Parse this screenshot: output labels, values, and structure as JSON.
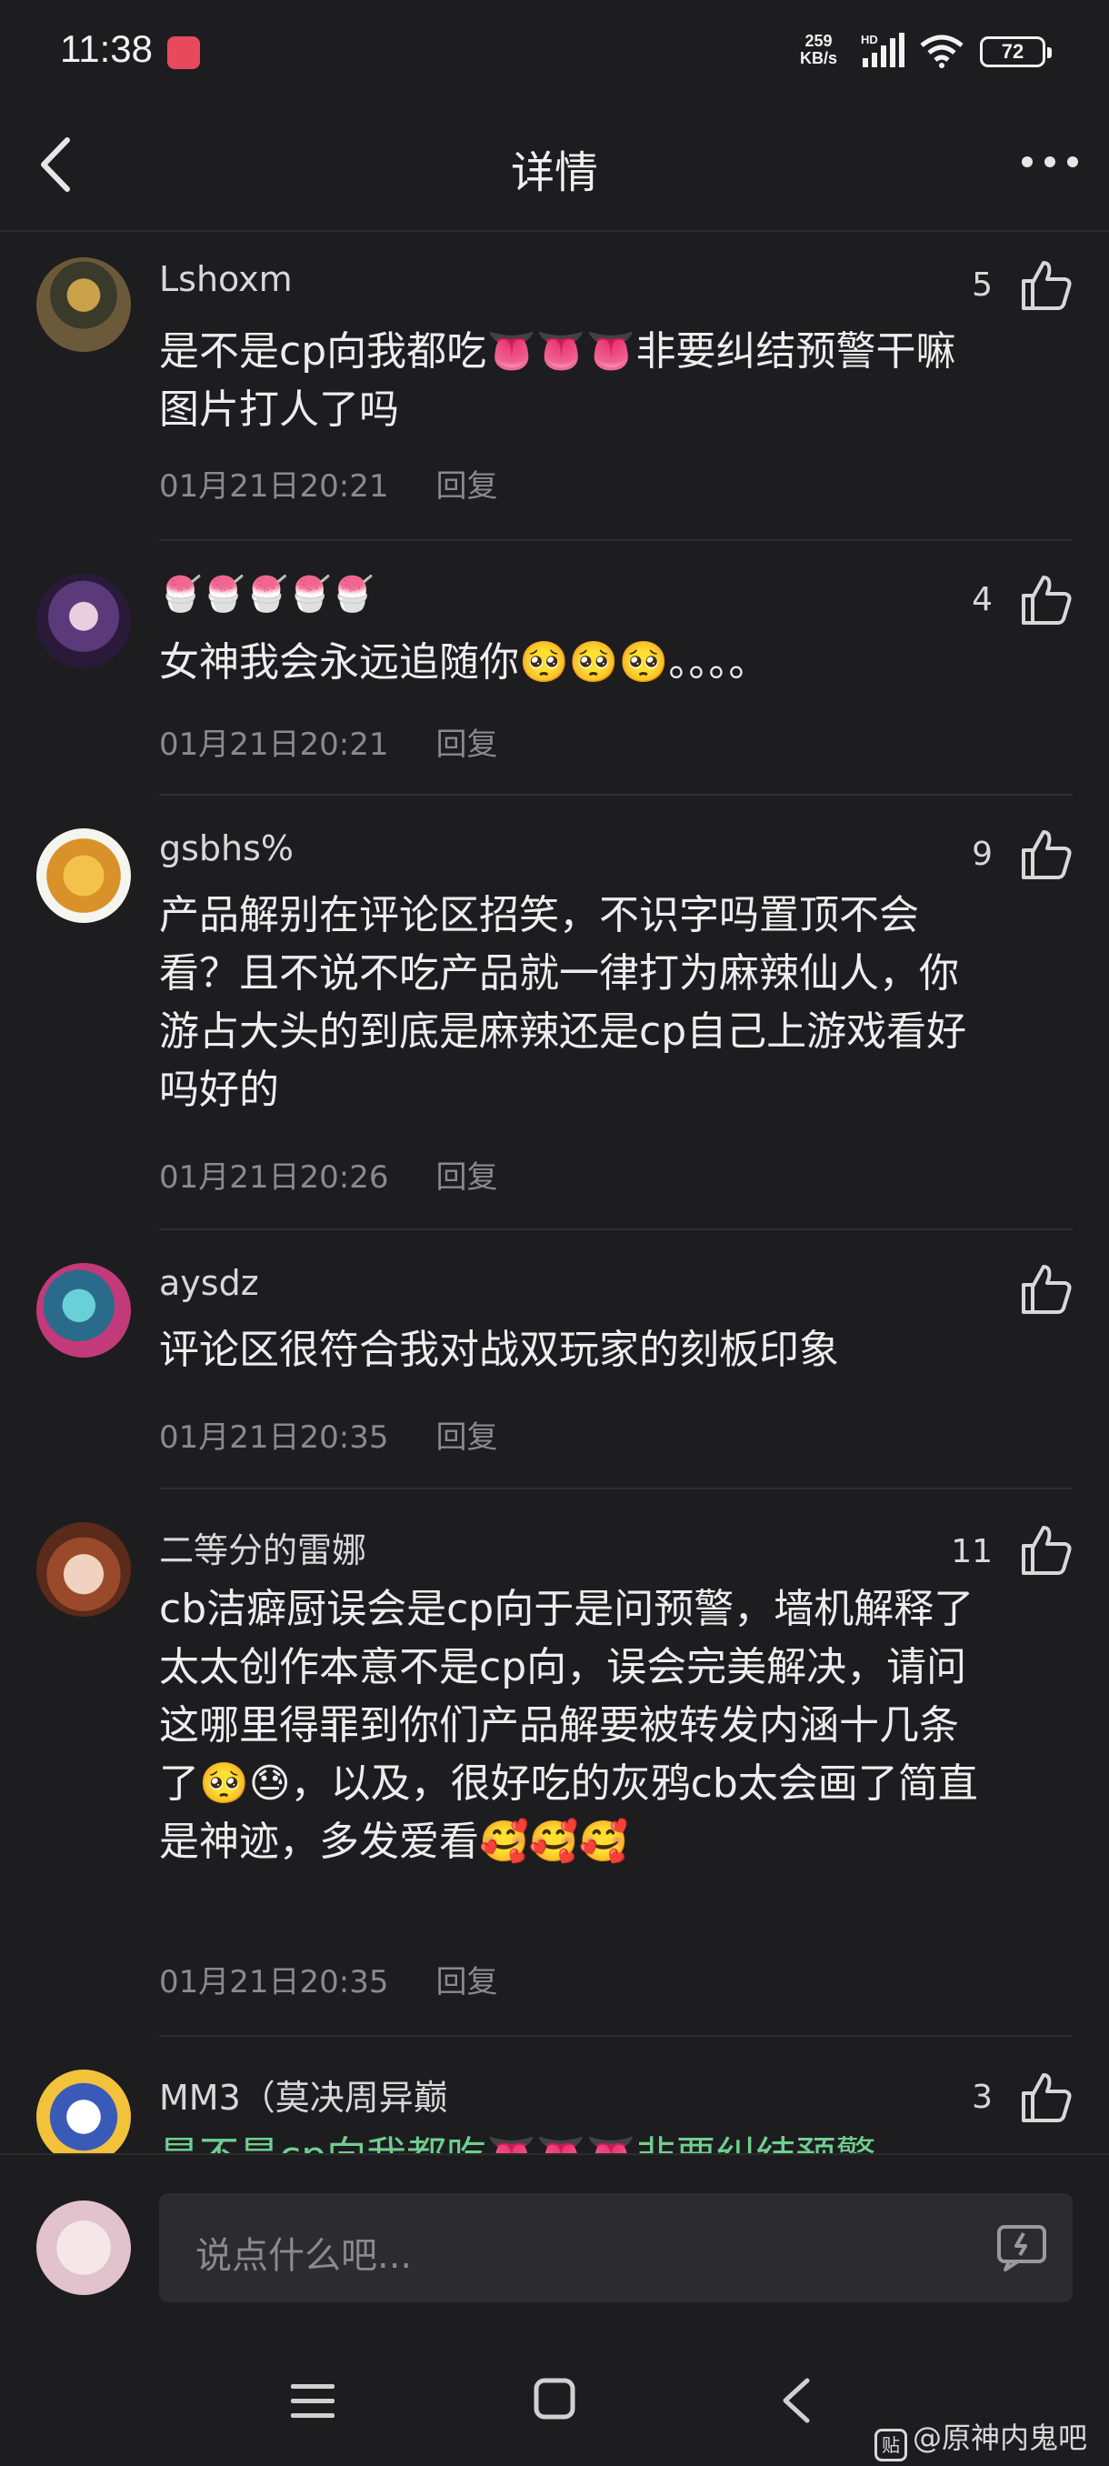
{
  "status_bar": {
    "time": "11:38",
    "net_speed_value": "259",
    "net_speed_unit": "KB/s",
    "network_label": "HD",
    "battery": "72",
    "icons": [
      "app-icon",
      "signal-icon",
      "wifi-icon",
      "battery-icon"
    ]
  },
  "header": {
    "title": "详情",
    "icons": [
      "back-arrow-icon",
      "more-dots-icon"
    ]
  },
  "comments": [
    {
      "username": "Lshoxm",
      "likes": "5",
      "content": "是不是cp向我都吃👅👅👅非要纠结预警干嘛图片打人了吗",
      "time": "01月21日20:21",
      "reply": "回复"
    },
    {
      "username": "🍧🍧🍧🍧🍧",
      "likes": "4",
      "content": "女神我会永远追随你🥺🥺🥺。。。。",
      "time": "01月21日20:21",
      "reply": "回复"
    },
    {
      "username": "gsbhs%",
      "likes": "9",
      "content": "产品解别在评论区招笑，不识字吗置顶不会看？且不说不吃产品就一律打为麻辣仙人，你游占大头的到底是麻辣还是cp自己上游戏看好吗好的",
      "time": "01月21日20:26",
      "reply": "回复"
    },
    {
      "username": "aysdz",
      "likes": "",
      "content": "评论区很符合我对战双玩家的刻板印象",
      "time": "01月21日20:35",
      "reply": "回复"
    },
    {
      "username": "二等分的雷娜",
      "likes": "11",
      "content": "cb洁癖厨误会是cp向于是问预警，墙机解释了太太创作本意不是cp向，误会完美解决，请问这哪里得罪到你们产品解要被转发内涵十几条了🥺😓，以及，很好吃的灰鸦cb太会画了简直是神迹，多发爱看🥰🥰🥰",
      "time": "01月21日20:35",
      "reply": "回复"
    },
    {
      "username": "MM3（莫决周异巅",
      "likes": "3",
      "content": "是不是cp向我都吃👅👅👅非要纠结预警",
      "time": "",
      "reply": ""
    }
  ],
  "input_bar": {
    "placeholder": "说点什么吧...",
    "icons": [
      "avatar",
      "emoji-pad-icon"
    ]
  },
  "system_nav": {
    "icons": [
      "menu-icon",
      "home-icon",
      "back-icon"
    ],
    "watermark_badge": "贴",
    "watermark_text": "@原神内鬼吧"
  }
}
